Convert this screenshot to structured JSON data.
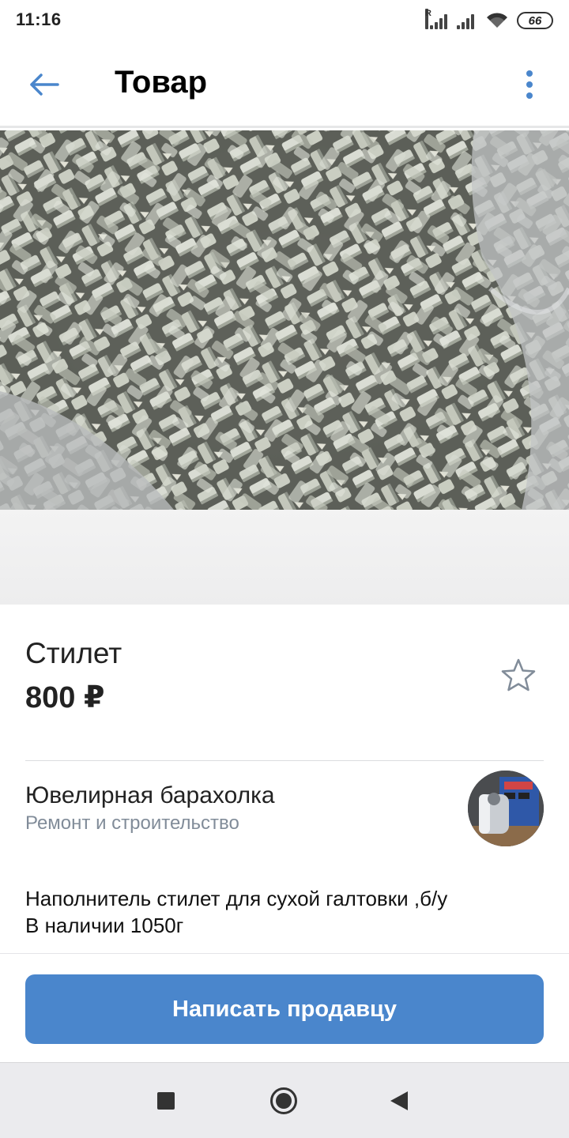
{
  "status_bar": {
    "time": "11:16",
    "battery": "66",
    "signal1_label": "R"
  },
  "header": {
    "title": "Товар",
    "back_icon": "arrow-left-icon",
    "more_icon": "more-vertical-icon"
  },
  "product": {
    "name": "Стилет",
    "price": "800 ₽",
    "favorite_icon": "star-outline-icon"
  },
  "seller": {
    "name": "Ювелирная барахолка",
    "category": "Ремонт и строительство"
  },
  "description": {
    "line1": "Наполнитель стилет для сухой галтовки ,б/у",
    "line2": "В наличии 1050г"
  },
  "actions": {
    "contact_label": "Написать продавцу"
  },
  "colors": {
    "accent": "#4a86cc",
    "secondary_text": "#818c99",
    "header_icon": "#4a86cc"
  }
}
